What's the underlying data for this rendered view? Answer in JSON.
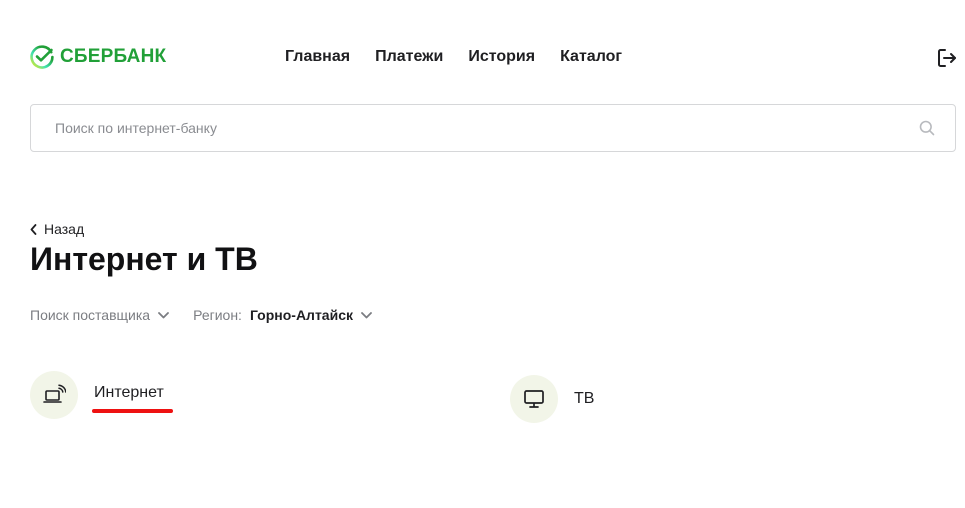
{
  "brand": {
    "name": "СБЕРБАНК",
    "color": "#21a038",
    "icon": "sber-logo-icon"
  },
  "nav": {
    "items": [
      {
        "label": "Главная"
      },
      {
        "label": "Платежи"
      },
      {
        "label": "История"
      },
      {
        "label": "Каталог"
      }
    ],
    "logout_icon": "logout-icon"
  },
  "search": {
    "placeholder": "Поиск по интернет-банку",
    "value": "",
    "icon": "search-icon"
  },
  "back": {
    "label": "Назад",
    "icon": "chevron-left-icon"
  },
  "page": {
    "title": "Интернет и ТВ"
  },
  "filters": {
    "provider_label": "Поиск поставщика",
    "region_label": "Регион:",
    "region_value": "Горно-Алтайск",
    "chevron_icon": "chevron-down-icon"
  },
  "categories": [
    {
      "label": "Интернет",
      "icon": "laptop-wifi-icon"
    },
    {
      "label": "ТВ",
      "icon": "monitor-icon"
    }
  ],
  "colors": {
    "accent_green": "#21a038",
    "icon_bg": "#f2f5e8",
    "highlight_red": "#ee1111",
    "muted_text": "#7b7d82"
  }
}
